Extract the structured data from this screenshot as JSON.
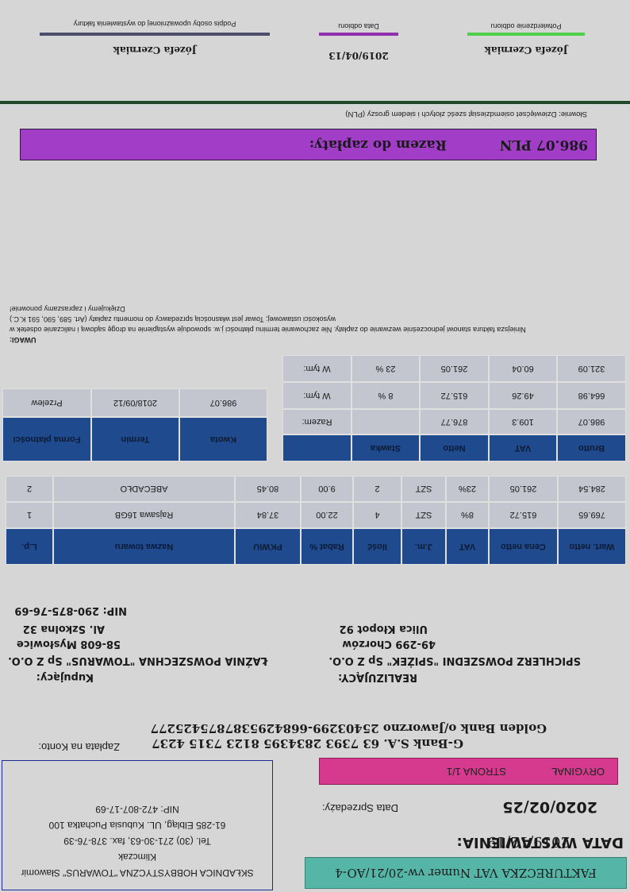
{
  "header": {
    "invoice_title": "FAKTURECZKA VAT Numer vw-20/21/AO-4",
    "issue_label": "DATA WYSTAWIENIA:",
    "issue_date": "2019/12/19",
    "sale_label": "Data Sprzedaży:",
    "sale_date": "2020/02/25",
    "original": "ORYGINAŁ",
    "page": "STRONA 1/1"
  },
  "issuer": {
    "name": "SKŁADNICA HOBBYSTYCZNA \"TOWARUS\" Sławomir",
    "name2": "Klimczak",
    "phone": "Tel. (30) 271-30-63,  fax. 378-76-39",
    "address": "61-285  Elbląg, UL. Kubusia Puchatka 100",
    "nip": "NIP: 472-807-17-69"
  },
  "payment": {
    "label": "Zapłata na Konto:",
    "bank1": "G-Bank S.A. 63 7393 2834395 8123 7315 4237",
    "bank2": "Golden Bank  o/Jaworzno 25403299-6684295387875425277"
  },
  "seller": {
    "title": "REALIZUJĄCY:",
    "name": "SPICHLERZ POWSZEDNI  \"SPIŻEK\" Sp Z O.O.",
    "city": "49-299 Chorzów",
    "street": "Ulica Kłopot 92"
  },
  "buyer": {
    "title": "Kupujący:",
    "name": "ŁAŹNIA POWSZECHNA \"TOWARUS\" Sp Z O.O.",
    "city": "58-608 Mysłowice",
    "street": "Al. Szkolna 32",
    "nip": "NIP: 290-875-76-69"
  },
  "items": {
    "headers": [
      "L.p.",
      "Nazwa  towaru",
      "PKWiU",
      "Rabat %",
      "Ilość",
      "J.m.",
      "VAT",
      "Cena  netto",
      "Wart.  netto"
    ],
    "rows": [
      [
        "1",
        "Rajsawa  16GB",
        "37.84",
        "22.00",
        "4",
        "SZT",
        "8%",
        "615.72",
        "769.65"
      ],
      [
        "2",
        "ABECADŁO",
        "80.45",
        "9.00",
        "2",
        "SZT",
        "23%",
        "261.05",
        "284.54"
      ]
    ]
  },
  "pay_terms": {
    "headers": [
      "Forma płatności",
      "Termin",
      "Kwota"
    ],
    "row": [
      "Przelew",
      "2018/09/12",
      "986.07"
    ]
  },
  "vat_summary": {
    "headers": [
      "",
      "Stawka",
      "Netto",
      "VAT",
      "Brutto"
    ],
    "rows": [
      [
        "Razem:",
        "",
        "876.77",
        "109.3",
        "986.07"
      ],
      [
        "W tym:",
        "8 %",
        "615.72",
        "49.26",
        "664.98"
      ],
      [
        "W tym:",
        "23 %",
        "261.05",
        "60.04",
        "321.09"
      ]
    ]
  },
  "notes": {
    "title": "UWAGI:",
    "line1": "Niniejsza faktura stanowi jednocześnie wezwanie do zapłaty. Nie zachowanie terminu płatności j.w. spowoduje wystąpienie na drogę sądową i naliczanie odsetek w",
    "line2": "wysokości ustawowej; Towar jest własnością sprzedawcy do momentu zapłaty (Art. 589, 590, 591 K.C.)",
    "line3": "Dziękujemy i zapraszamy ponownie!"
  },
  "total": {
    "label": "Razem do zapłaty:",
    "value": "986.07 PLN",
    "words": "Słownie:  Dziewięćset osiemdziesiąt sześć złotych i siedem groszy (PLN)"
  },
  "signatures": {
    "receipt_label": "Potwierdzenie odbioru",
    "receipt_name": "Józefa Czerniak",
    "date_label": "Data odbioru",
    "date_value": "2019/04/13",
    "auth_label": "Podpis osoby upoważnionej do wystawienia faktury",
    "auth_name": "Józefa  Czerniak"
  },
  "colors": {
    "title_bar": "#55b5a6",
    "original_bar": "#d63a8e",
    "table_header": "#1f4a8e",
    "table_row": "#c3c6cf",
    "total_bar": "#a13dc6",
    "divider": "#1f4a2a"
  }
}
